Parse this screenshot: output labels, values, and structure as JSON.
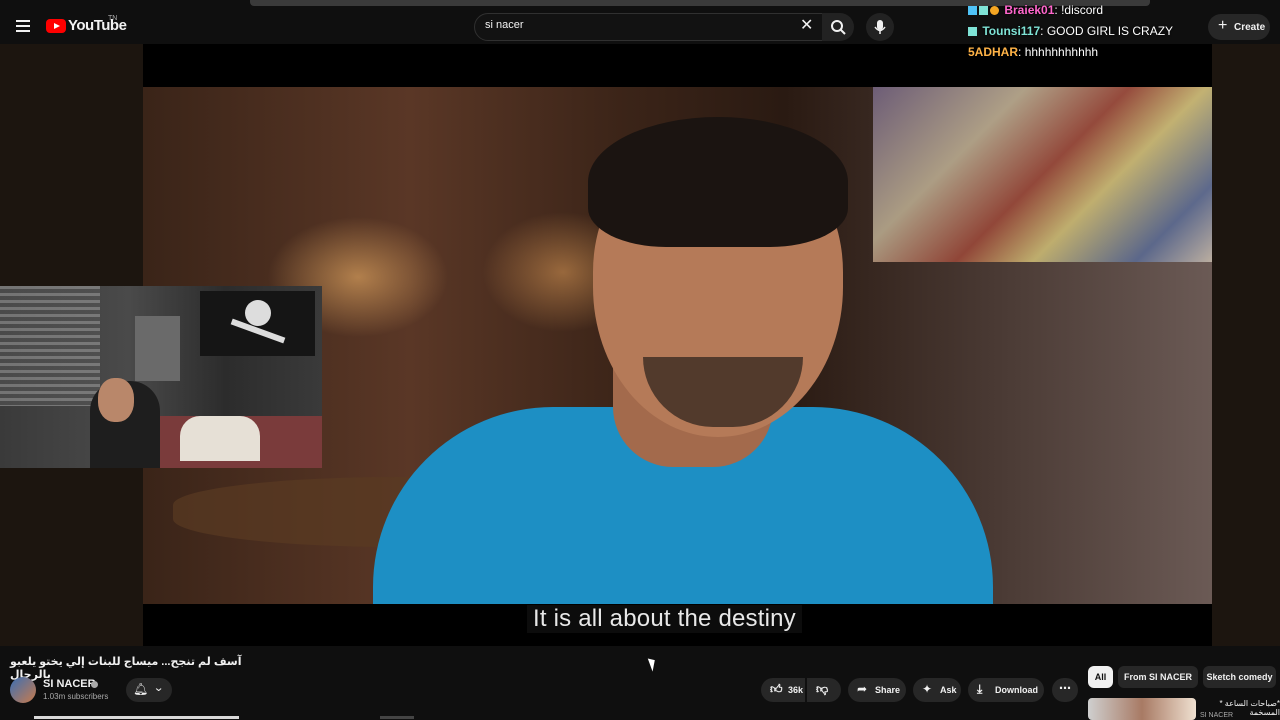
{
  "header": {
    "logo_text": "YouTube",
    "logo_tm": "TN",
    "search_value": "si nacer",
    "create_label": "Create"
  },
  "chat": [
    {
      "user": "Braiek01",
      "message": "!discord",
      "color": "#ff66cc"
    },
    {
      "user": "Tounsi117",
      "message": "GOOD GIRL IS CRAZY",
      "color": "#7fe3d6"
    },
    {
      "user": "5ADHAR",
      "message": "hhhhhhhhhhh",
      "color": "#ffb347"
    }
  ],
  "player": {
    "caption": "It is all about the destiny"
  },
  "video": {
    "title": "آسف لم تنجح... ميساج للبنات إلي يختو يلعبو بالرجال",
    "channel": "SI NACER",
    "subscribers": "1.03m subscribers",
    "likes": "36k",
    "share_label": "Share",
    "ask_label": "Ask",
    "download_label": "Download"
  },
  "chips": [
    "All",
    "From SI NACER",
    "Sketch comedy"
  ],
  "recommendation": {
    "title": "*صباحات الساعة * المسخمة",
    "channel": "SI NACER"
  },
  "icons": [
    "menu-icon",
    "youtube-logo-icon",
    "close-icon",
    "search-icon",
    "mic-icon",
    "plus-icon",
    "bell-icon",
    "chevron-down-icon",
    "thumbs-up-icon",
    "thumbs-down-icon",
    "share-icon",
    "sparkle-icon",
    "download-icon",
    "more-icon"
  ]
}
